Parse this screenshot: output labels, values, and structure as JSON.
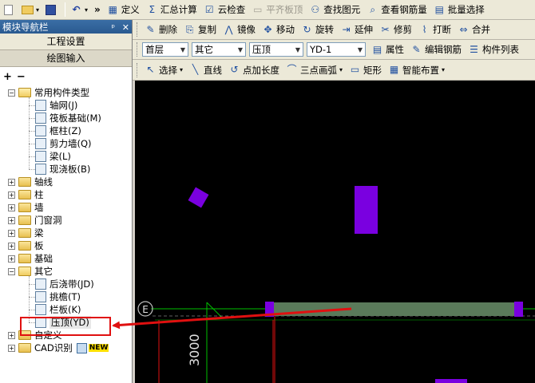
{
  "toolbar1": {
    "items": [
      {
        "name": "define-button",
        "label": "定义",
        "icon": "define-icon"
      },
      {
        "name": "summary-calc-button",
        "label": "汇总计算",
        "icon": "sigma-icon"
      },
      {
        "name": "cloud-check-button",
        "label": "云检查",
        "icon": "cloud-check-icon"
      },
      {
        "name": "flush-slab-button",
        "label": "平齐板顶",
        "icon": "flush-icon",
        "disabled": true
      },
      {
        "name": "find-element-button",
        "label": "查找图元",
        "icon": "binoculars-icon"
      },
      {
        "name": "view-rebar-button",
        "label": "查看钢筋量",
        "icon": "magnifier-icon"
      },
      {
        "name": "batch-select-button",
        "label": "批量选择",
        "icon": "batch-icon"
      }
    ]
  },
  "toolbar2": {
    "items": [
      {
        "name": "delete-button",
        "label": "删除",
        "icon": "pencil-icon"
      },
      {
        "name": "copy-button",
        "label": "复制",
        "icon": "copy-icon"
      },
      {
        "name": "mirror-button",
        "label": "镜像",
        "icon": "mirror-icon"
      },
      {
        "name": "move-button",
        "label": "移动",
        "icon": "move-icon"
      },
      {
        "name": "rotate-button",
        "label": "旋转",
        "icon": "rotate-icon"
      },
      {
        "name": "extend-button",
        "label": "延伸",
        "icon": "extend-icon"
      },
      {
        "name": "trim-button",
        "label": "修剪",
        "icon": "trim-icon"
      },
      {
        "name": "break-button",
        "label": "打断",
        "icon": "break-icon"
      },
      {
        "name": "merge-button",
        "label": "合并",
        "icon": "merge-icon"
      }
    ]
  },
  "toolbar3": {
    "combos": [
      {
        "name": "floor-select",
        "value": "首层"
      },
      {
        "name": "category-select",
        "value": "其它"
      },
      {
        "name": "type-select",
        "value": "压顶"
      },
      {
        "name": "component-select",
        "value": "YD-1"
      }
    ],
    "items": [
      {
        "name": "properties-button",
        "label": "属性",
        "icon": "properties-icon"
      },
      {
        "name": "edit-rebar-button",
        "label": "编辑钢筋",
        "icon": "edit-rebar-icon"
      },
      {
        "name": "component-list-button",
        "label": "构件列表",
        "icon": "list-icon"
      }
    ]
  },
  "toolbar4": {
    "items": [
      {
        "name": "select-button",
        "label": "选择",
        "icon": "cursor-icon",
        "dropdown": true
      },
      {
        "name": "line-button",
        "label": "直线",
        "icon": "line-icon"
      },
      {
        "name": "point-length-button",
        "label": "点加长度",
        "icon": "point-length-icon"
      },
      {
        "name": "three-point-arc-button",
        "label": "三点画弧",
        "icon": "arc-icon",
        "dropdown": true
      },
      {
        "name": "rectangle-button",
        "label": "矩形",
        "icon": "rectangle-icon"
      },
      {
        "name": "smart-layout-button",
        "label": "智能布置",
        "icon": "smart-layout-icon",
        "dropdown": true
      }
    ]
  },
  "panel": {
    "title": "模块导航栏",
    "pin": "ᵖ",
    "close": "✕",
    "sections": [
      {
        "label": "工程设置"
      },
      {
        "label": "绘图输入"
      }
    ],
    "tools": [
      "+",
      "−"
    ]
  },
  "tree": {
    "groups": [
      {
        "label": "常用构件类型",
        "expanded": true,
        "children": [
          {
            "label": "轴网(J)",
            "icon": "grid-icon"
          },
          {
            "label": "筏板基础(M)",
            "icon": "raft-icon"
          },
          {
            "label": "框柱(Z)",
            "icon": "column-icon"
          },
          {
            "label": "剪力墙(Q)",
            "icon": "shear-wall-icon"
          },
          {
            "label": "梁(L)",
            "icon": "beam-icon"
          },
          {
            "label": "现浇板(B)",
            "icon": "slab-icon"
          }
        ]
      },
      {
        "label": "轴线",
        "expanded": false
      },
      {
        "label": "柱",
        "expanded": false
      },
      {
        "label": "墙",
        "expanded": false
      },
      {
        "label": "门窗洞",
        "expanded": false
      },
      {
        "label": "梁",
        "expanded": false
      },
      {
        "label": "板",
        "expanded": false
      },
      {
        "label": "基础",
        "expanded": false
      },
      {
        "label": "其它",
        "expanded": true,
        "children": [
          {
            "label": "后浇带(JD)",
            "icon": "post-cast-icon"
          },
          {
            "label": "挑檐(T)",
            "icon": "eave-icon"
          },
          {
            "label": "栏板(K)",
            "icon": "parapet-icon"
          },
          {
            "label": "压顶(YD)",
            "icon": "coping-icon",
            "selected": true
          }
        ]
      },
      {
        "label": "自定义",
        "expanded": false
      },
      {
        "label": "CAD识别",
        "expanded": false,
        "badge": "NEW"
      }
    ]
  },
  "canvas": {
    "axis_label": "E",
    "dimension_label": "3000",
    "colors": {
      "background": "#000000",
      "element": "#7a00e0",
      "coping": "#5a7a5a",
      "axis": "#00c000",
      "annotation": "#e01010",
      "dimension": "#c0c0c0"
    }
  }
}
